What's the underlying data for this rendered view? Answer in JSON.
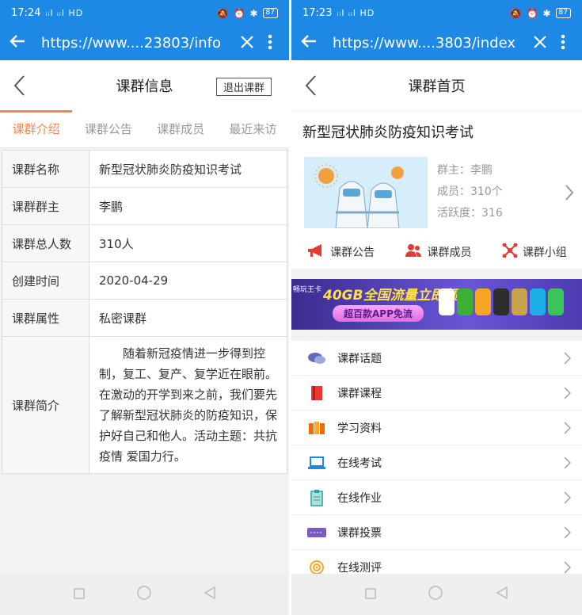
{
  "left": {
    "status": {
      "time": "17:24",
      "signal": "ᵢᵢl ᵢᵢl HD",
      "battery": "87"
    },
    "browser": {
      "url": "https://www....23803/info"
    },
    "header": {
      "title": "课群信息",
      "exit_label": "退出课群"
    },
    "tabs": [
      {
        "label": "课群介绍",
        "active": true
      },
      {
        "label": "课群公告",
        "active": false
      },
      {
        "label": "课群成员",
        "active": false
      },
      {
        "label": "最近来访",
        "active": false
      }
    ],
    "info_rows": [
      {
        "key": "课群名称",
        "value": "新型冠状肺炎防疫知识考试"
      },
      {
        "key": "课群群主",
        "value": "李鹏"
      },
      {
        "key": "课群总人数",
        "value": "310人"
      },
      {
        "key": "创建时间",
        "value": "2020-04-29"
      },
      {
        "key": "课群属性",
        "value": "私密课群"
      },
      {
        "key": "课群简介",
        "value": "随着新冠疫情进一步得到控制，复工、复产、复学近在眼前。在激动的开学到来之前，我们要先了解新型冠状肺炎的防疫知识，保护好自己和他人。活动主题：共抗疫情 爱国力行。"
      }
    ]
  },
  "right": {
    "status": {
      "time": "17:23",
      "signal": "ᵢᵢl ᵢᵢl HD",
      "battery": "87"
    },
    "browser": {
      "url": "https://www....3803/index"
    },
    "header": {
      "title": "课群首页"
    },
    "course": {
      "name": "新型冠状肺炎防疫知识考试",
      "owner": "群主：李鹏",
      "members": "成员：310个",
      "activity": "活跃度：316"
    },
    "quick_links": [
      {
        "label": "课群公告",
        "icon": "megaphone-icon",
        "color": "#e53935"
      },
      {
        "label": "课群成员",
        "icon": "people-icon",
        "color": "#e53935"
      },
      {
        "label": "课群小组",
        "icon": "network-icon",
        "color": "#e53935"
      }
    ],
    "banner": {
      "headline": "40GB全国流量立即领",
      "sub": "超百款APP免流",
      "tag": "畅玩王卡"
    },
    "menu": [
      {
        "label": "课群话题",
        "icon": "chat-bubbles-icon",
        "color": "#5c6bc0"
      },
      {
        "label": "课群课程",
        "icon": "book-icon",
        "color": "#e53935"
      },
      {
        "label": "学习资料",
        "icon": "books-icon",
        "color": "#ef6c00"
      },
      {
        "label": "在线考试",
        "icon": "laptop-icon",
        "color": "#1e88e5"
      },
      {
        "label": "在线作业",
        "icon": "clipboard-icon",
        "color": "#26a69a"
      },
      {
        "label": "课群投票",
        "icon": "ticket-icon",
        "color": "#7e57c2"
      },
      {
        "label": "在线测评",
        "icon": "target-icon",
        "color": "#f9a825"
      }
    ]
  },
  "colors": {
    "browser_bar": "#1e88e5",
    "active_tab": "#f0874f"
  }
}
